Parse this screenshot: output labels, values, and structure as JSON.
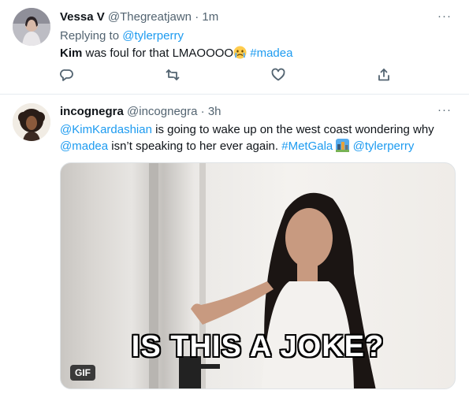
{
  "tweets": [
    {
      "display_name": "Vessa V",
      "handle": "@Thegreatjawn",
      "separator": "·",
      "time": "1m",
      "replying_prefix": "Replying to",
      "replying_handle": "@tylerperry",
      "text_bold": "Kim",
      "text": " was foul for that LMAOOOO",
      "emoji": "crying-face-emoji",
      "hashtag": "#madea"
    },
    {
      "display_name": "incognegra",
      "handle": "@incognegra",
      "separator": "·",
      "time": "3h",
      "mention1": "@KimKardashian",
      "line1_rest": " is going to wake up on the west coast wondering why",
      "mention2": "@madea",
      "line2_rest": " isn’t speaking to her ever again. ",
      "hashtag": "#MetGala",
      "emoji": "city-emoji",
      "mention3": "@tylerperry",
      "media": {
        "caption": "IS THIS A JOKE?",
        "badge": "GIF"
      }
    }
  ],
  "more_label": "···",
  "colors": {
    "link": "#1d9bf0",
    "muted": "#536471",
    "text": "#0f1419"
  }
}
